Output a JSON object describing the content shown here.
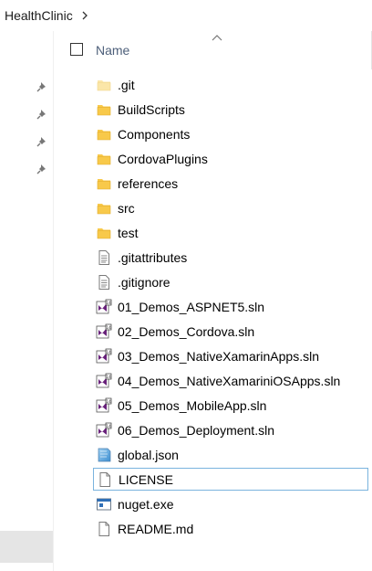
{
  "breadcrumb": {
    "folder": "HealthClinic",
    "chevron_icon": "chevron-right-icon"
  },
  "header": {
    "name_label": "Name",
    "sort": "ascending"
  },
  "quick_access_pins": 4,
  "files": [
    {
      "name": ".git",
      "type": "folder",
      "faded": true
    },
    {
      "name": "BuildScripts",
      "type": "folder"
    },
    {
      "name": "Components",
      "type": "folder"
    },
    {
      "name": "CordovaPlugins",
      "type": "folder"
    },
    {
      "name": "references",
      "type": "folder"
    },
    {
      "name": "src",
      "type": "folder"
    },
    {
      "name": "test",
      "type": "folder"
    },
    {
      "name": ".gitattributes",
      "type": "text"
    },
    {
      "name": ".gitignore",
      "type": "text"
    },
    {
      "name": "01_Demos_ASPNET5.sln",
      "type": "sln"
    },
    {
      "name": "02_Demos_Cordova.sln",
      "type": "sln"
    },
    {
      "name": "03_Demos_NativeXamarinApps.sln",
      "type": "sln"
    },
    {
      "name": "04_Demos_NativeXamariniOSApps.sln",
      "type": "sln"
    },
    {
      "name": "05_Demos_MobileApp.sln",
      "type": "sln"
    },
    {
      "name": "06_Demos_Deployment.sln",
      "type": "sln"
    },
    {
      "name": "global.json",
      "type": "json"
    },
    {
      "name": "LICENSE",
      "type": "blank",
      "selected": true
    },
    {
      "name": "nuget.exe",
      "type": "exe"
    },
    {
      "name": "README.md",
      "type": "blank"
    }
  ],
  "colors": {
    "folder": "#f8c94a",
    "selection_border": "#7ab3de",
    "vs_purple": "#68217a"
  }
}
